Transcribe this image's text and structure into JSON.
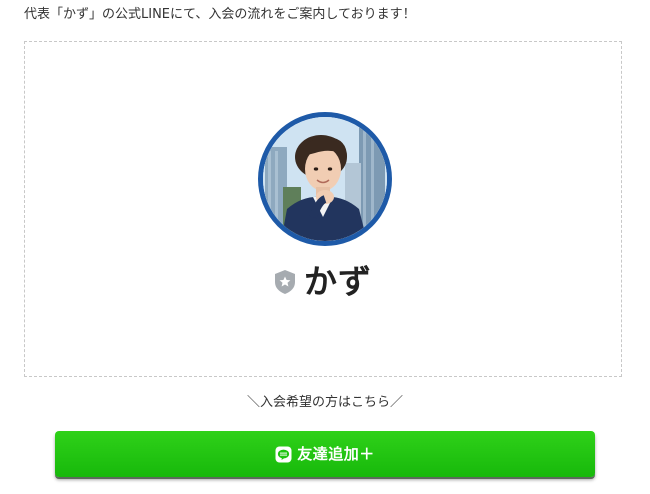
{
  "intro": {
    "text": "代表「かず」の公式LINEにて、入会の流れをご案内しております！"
  },
  "profile": {
    "name": "かず",
    "avatar_alt": "profile photo",
    "avatar_ring_color": "#1e5aa8",
    "badge_icon": "shield-star-icon"
  },
  "cta": {
    "caption": "＼入会希望の方はこちら／",
    "button_label": "友達追加＋",
    "button_icon": "line-icon",
    "button_color": "#1fc410"
  }
}
